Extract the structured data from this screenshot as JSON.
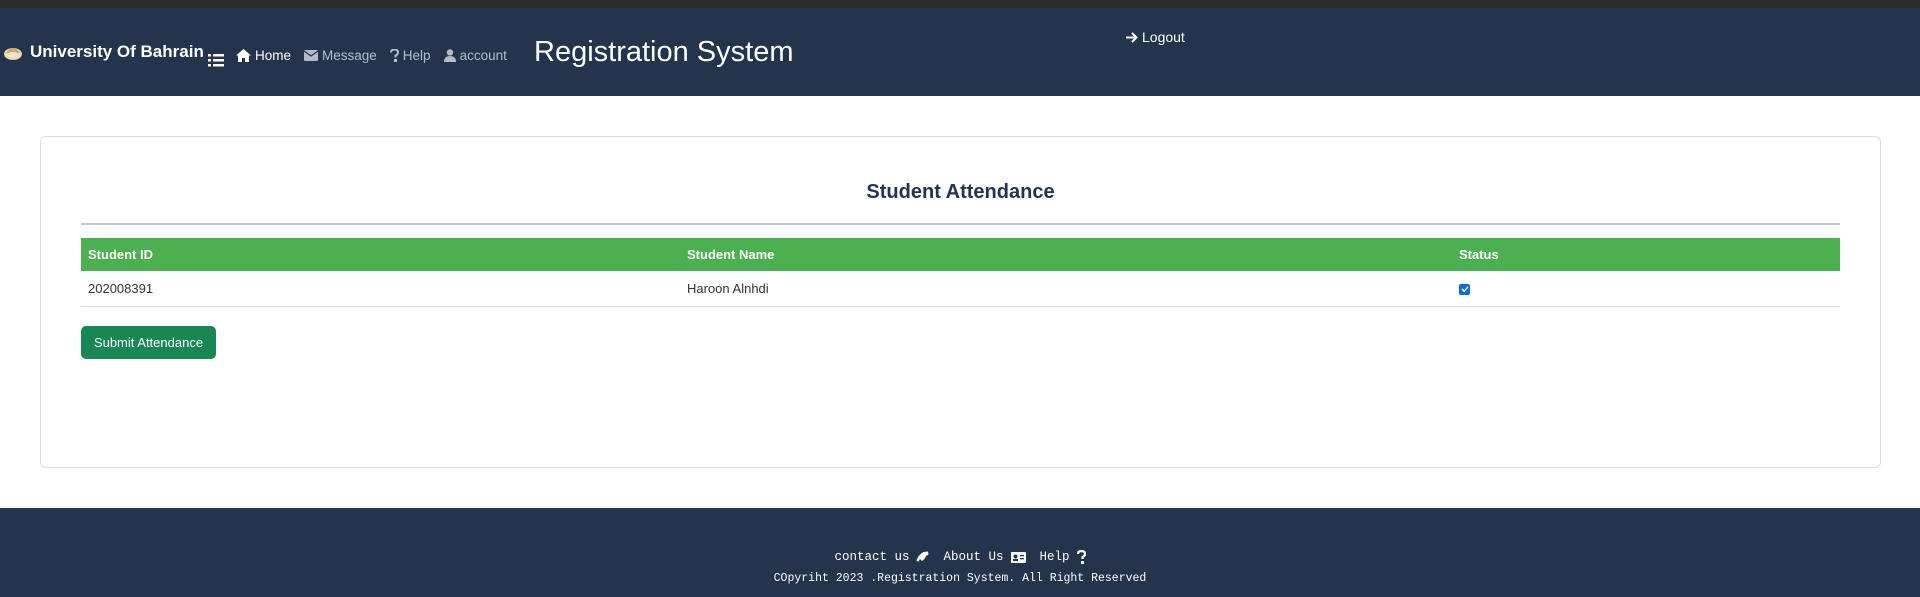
{
  "brand": {
    "name": "University Of Bahrain"
  },
  "nav": {
    "items": [
      {
        "label": "Home",
        "icon": "home-icon"
      },
      {
        "label": "Message",
        "icon": "envelope-icon"
      },
      {
        "label": "Help",
        "icon": "question-icon"
      },
      {
        "label": "account",
        "icon": "user-icon"
      }
    ],
    "title": "Registration System",
    "logout_label": "Logout"
  },
  "card": {
    "title": "Student Attendance",
    "table": {
      "headers": [
        "Student ID",
        "Student Name",
        "Status"
      ],
      "rows": [
        {
          "student_id": "202008391",
          "student_name": "Haroon Alnhdi",
          "status_checked": true
        }
      ]
    },
    "submit_label": "Submit Attendance"
  },
  "footer": {
    "links": [
      {
        "label": "contact us",
        "icon": "phone-icon"
      },
      {
        "label": "About Us",
        "icon": "id-card-icon"
      },
      {
        "label": "Help",
        "icon": "question-icon"
      }
    ],
    "copyright": "COpyriht 2023 .Registration System. All Right Reserved"
  },
  "colors": {
    "navbar": "#24344d",
    "table_header": "#4caf50",
    "submit_button": "#198754",
    "checkbox": "#0b6fd6"
  }
}
